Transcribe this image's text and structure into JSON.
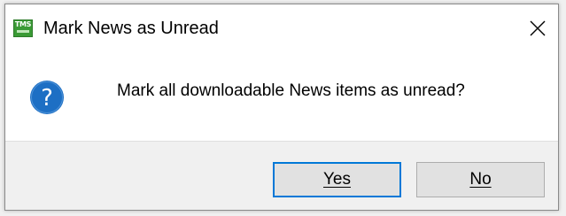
{
  "dialog": {
    "title": "Mark News as Unread",
    "app_icon_text": "TMS",
    "close_icon": "close-icon",
    "message": "Mark all downloadable News items as unread?",
    "message_icon": "question-icon",
    "accent_color": "#0078d7",
    "question_icon_color": "#1d6fc4",
    "app_icon_color": "#3a9a35"
  },
  "buttons": {
    "yes_label": "Yes",
    "no_label": "No",
    "default_button": "Yes"
  }
}
